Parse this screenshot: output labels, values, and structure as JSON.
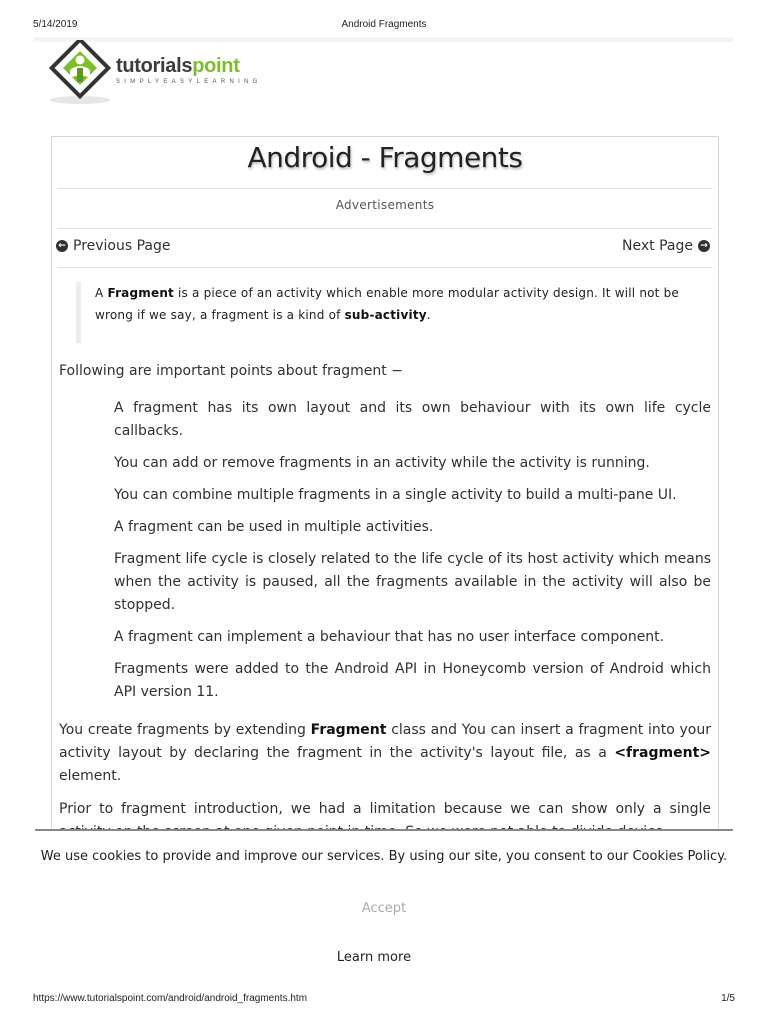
{
  "print_header": {
    "date": "5/14/2019",
    "title": "Android Fragments"
  },
  "logo": {
    "name_main": "tutorials",
    "name_accent": "point",
    "tagline": "SIMPLYEASYLEARNING",
    "accent_color": "#7cbf2c"
  },
  "page": {
    "title": "Android - Fragments",
    "advertisements": "Advertisements",
    "prev_label": "Previous Page",
    "next_label": "Next Page"
  },
  "intro": {
    "t1": "A ",
    "b1": "Fragment",
    "t2": " is a piece of an activity which enable more modular activity design. It will not be wrong if we say, a fragment is a kind of ",
    "b2": "sub-activity",
    "t3": "."
  },
  "lead": "Following are important points about fragment −",
  "points": [
    "A fragment has its own layout and its own behaviour with its own life cycle callbacks.",
    "You can add or remove fragments in an activity while the activity is running.",
    "You can combine multiple fragments in a single activity to build a multi-pane UI.",
    "A fragment can be used in multiple activities.",
    "Fragment life cycle is closely related to the life cycle of its host activity which means when the activity is paused, all the fragments available in the activity will also be stopped.",
    "A fragment can implement a behaviour that has no user interface component.",
    "Fragments were added to the Android API in Honeycomb version of Android which API version 11."
  ],
  "para1": {
    "t1": "You create fragments by extending ",
    "b1": "Fragment",
    "t2": " class and You can insert a fragment into your activity layout by declaring the fragment in the activity's layout file, as a ",
    "b2": "<fragment>",
    "t3": " element."
  },
  "para2": "Prior to fragment introduction, we had a limitation because we can show only a single activity on the screen at one given point in time. So we were not able to divide device",
  "cookie": {
    "text": "We use cookies to provide and improve our services. By using our site, you consent to our Cookies Policy.",
    "accept": "Accept",
    "learn_more": "Learn more"
  },
  "print_footer": {
    "url": "https://www.tutorialspoint.com/android/android_fragments.htm",
    "page": "1/5"
  }
}
